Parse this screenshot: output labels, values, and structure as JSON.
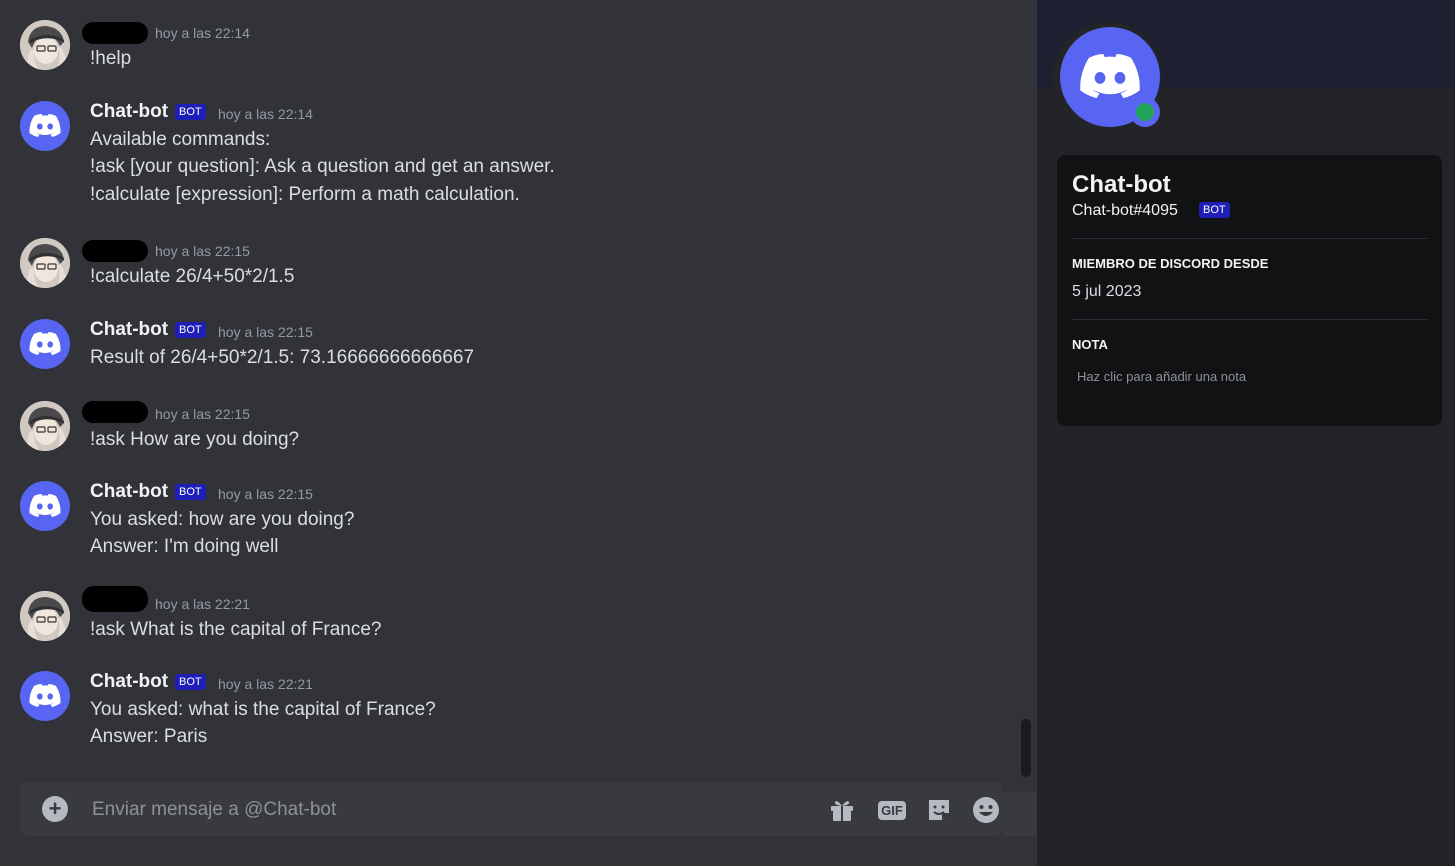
{
  "colors": {
    "blurple": "#5865f2",
    "online": "#23a559",
    "bot_badge": "#1d1fb6"
  },
  "messages": [
    {
      "author": "",
      "is_bot": false,
      "timestamp": "hoy a las 22:14",
      "lines": [
        "!help"
      ]
    },
    {
      "author": "Chat-bot",
      "is_bot": true,
      "badge": "BOT",
      "timestamp": "hoy a las 22:14",
      "lines": [
        "Available commands:",
        "!ask [your question]: Ask a question and get an answer.",
        "!calculate [expression]: Perform a math calculation."
      ]
    },
    {
      "author": "",
      "is_bot": false,
      "timestamp": "hoy a las 22:15",
      "lines": [
        "!calculate 26/4+50*2/1.5"
      ]
    },
    {
      "author": "Chat-bot",
      "is_bot": true,
      "badge": "BOT",
      "timestamp": "hoy a las 22:15",
      "lines": [
        "Result of 26/4+50*2/1.5: 73.16666666666667"
      ]
    },
    {
      "author": "",
      "is_bot": false,
      "timestamp": "hoy a las 22:15",
      "lines": [
        "!ask How are you doing?"
      ]
    },
    {
      "author": "Chat-bot",
      "is_bot": true,
      "badge": "BOT",
      "timestamp": "hoy a las 22:15",
      "lines": [
        "You asked: how are you doing?",
        "Answer: I'm doing well"
      ]
    },
    {
      "author": "",
      "is_bot": false,
      "timestamp": "hoy a las 22:21",
      "lines": [
        "!ask What is the capital of France?"
      ]
    },
    {
      "author": "Chat-bot",
      "is_bot": true,
      "badge": "BOT",
      "timestamp": "hoy a las 22:21",
      "lines": [
        "You asked: what is the capital of France?",
        "Answer: Paris"
      ]
    }
  ],
  "composer": {
    "placeholder": "Enviar mensaje a @Chat-bot",
    "icons": [
      "plus-circle-icon",
      "gift-icon",
      "gif-icon",
      "sticker-icon",
      "emoji-icon"
    ],
    "gif_label": "GIF"
  },
  "profile": {
    "name": "Chat-bot",
    "tag": "Chat-bot#4095",
    "badge": "BOT",
    "status": "online",
    "member_since_title": "MIEMBRO DE DISCORD DESDE",
    "member_since_value": "5 jul 2023",
    "note_title": "NOTA",
    "note_placeholder": "Haz clic para añadir una nota"
  }
}
